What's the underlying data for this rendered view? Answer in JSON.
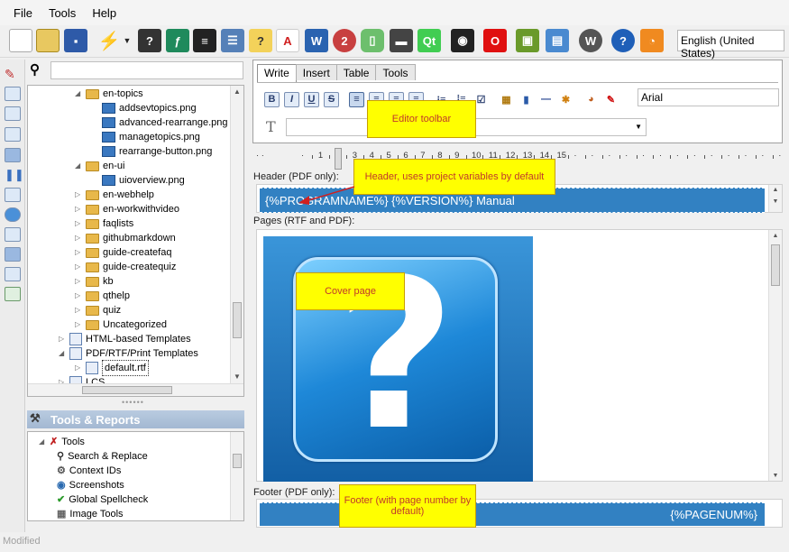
{
  "menu": {
    "file": "File",
    "tools": "Tools",
    "help": "Help"
  },
  "toolbar": {
    "language": "English (United States)"
  },
  "tree": {
    "items": [
      {
        "label": "en-topics",
        "type": "folder",
        "indent": 1,
        "expanded": true
      },
      {
        "label": "addsevtopics.png",
        "type": "file",
        "indent": 2
      },
      {
        "label": "advanced-rearrange.png",
        "type": "file",
        "indent": 2
      },
      {
        "label": "managetopics.png",
        "type": "file",
        "indent": 2
      },
      {
        "label": "rearrange-button.png",
        "type": "file",
        "indent": 2
      },
      {
        "label": "en-ui",
        "type": "folder",
        "indent": 1,
        "expanded": true
      },
      {
        "label": "uioverview.png",
        "type": "file",
        "indent": 2
      },
      {
        "label": "en-webhelp",
        "type": "folder",
        "indent": 1
      },
      {
        "label": "en-workwithvideo",
        "type": "folder",
        "indent": 1
      },
      {
        "label": "faqlists",
        "type": "folder",
        "indent": 1
      },
      {
        "label": "githubmarkdown",
        "type": "folder",
        "indent": 1
      },
      {
        "label": "guide-createfaq",
        "type": "folder",
        "indent": 1
      },
      {
        "label": "guide-createquiz",
        "type": "folder",
        "indent": 1
      },
      {
        "label": "kb",
        "type": "folder",
        "indent": 1
      },
      {
        "label": "qthelp",
        "type": "folder",
        "indent": 1
      },
      {
        "label": "quiz",
        "type": "folder",
        "indent": 1
      },
      {
        "label": "Uncategorized",
        "type": "folder",
        "indent": 1
      },
      {
        "label": "HTML-based Templates",
        "type": "doc",
        "indent": 0
      },
      {
        "label": "PDF/RTF/Print Templates",
        "type": "doc",
        "indent": 0,
        "expanded": true
      },
      {
        "label": "default.rtf",
        "type": "doc",
        "indent": 1,
        "selected": true
      },
      {
        "label": "LCS",
        "type": "doc",
        "indent": 0
      }
    ]
  },
  "tools_panel": {
    "title": "Tools & Reports",
    "items": [
      {
        "label": "Tools",
        "indent": 0
      },
      {
        "label": "Search & Replace",
        "indent": 1
      },
      {
        "label": "Context IDs",
        "indent": 1
      },
      {
        "label": "Screenshots",
        "indent": 1
      },
      {
        "label": "Global Spellcheck",
        "indent": 1
      },
      {
        "label": "Image Tools",
        "indent": 1
      }
    ]
  },
  "editor": {
    "tabs": [
      "Write",
      "Insert",
      "Table",
      "Tools"
    ],
    "font": "Arial",
    "style": ""
  },
  "ruler": {
    "numbers": [
      "1",
      "2",
      "3",
      "4",
      "5",
      "6",
      "7",
      "8",
      "9",
      "10",
      "11",
      "12",
      "13",
      "14",
      "15"
    ]
  },
  "header": {
    "label": "Header (PDF only):",
    "content": "{%PROGRAMNAME%} {%VERSION%} Manual"
  },
  "pages": {
    "label": "Pages (RTF and PDF):"
  },
  "footer": {
    "label": "Footer (PDF only):",
    "content": "{%PAGENUM%}"
  },
  "callouts": {
    "editor_toolbar": "Editor toolbar",
    "header": "Header, uses project variables by default",
    "cover": "Cover page",
    "footer": "Footer (with page number by default)"
  },
  "status": {
    "text": "Modified"
  },
  "colors": {
    "accent": "#3281c2",
    "callout": "#ffff00",
    "callout_text": "#c0392b"
  }
}
